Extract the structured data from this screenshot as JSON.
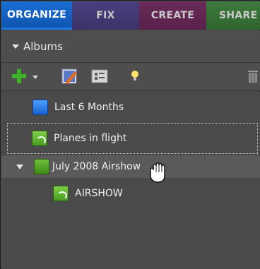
{
  "tabs": [
    {
      "label": "ORGANIZE",
      "active": true
    },
    {
      "label": "FIX"
    },
    {
      "label": "CREATE"
    },
    {
      "label": "SHARE"
    }
  ],
  "albums_panel": {
    "title": "Albums",
    "toolbar": {
      "icons": [
        "add-icon",
        "chevron-down-icon",
        "edit-icon",
        "organizer-icon",
        "lightbulb-icon",
        "trash-icon"
      ]
    },
    "items": [
      {
        "label": "Last 6 Months",
        "icon": "album-blue-icon",
        "level": 0
      },
      {
        "label": "Planes in flight",
        "icon": "smart-album-icon",
        "level": 0,
        "state": "focused"
      },
      {
        "label": "July 2008 Airshow",
        "icon": "album-group-icon",
        "level": 0,
        "expanded": true,
        "state": "hover"
      },
      {
        "label": "AIRSHOW",
        "icon": "smart-album-icon",
        "level": 1
      }
    ]
  },
  "colors": {
    "organize_tab": "#1a6fd4",
    "fix_tab": "#4a3f7e",
    "create_tab": "#6a2b5a",
    "share_tab": "#3c7a3c",
    "panel_bg": "#4a4a4a"
  }
}
